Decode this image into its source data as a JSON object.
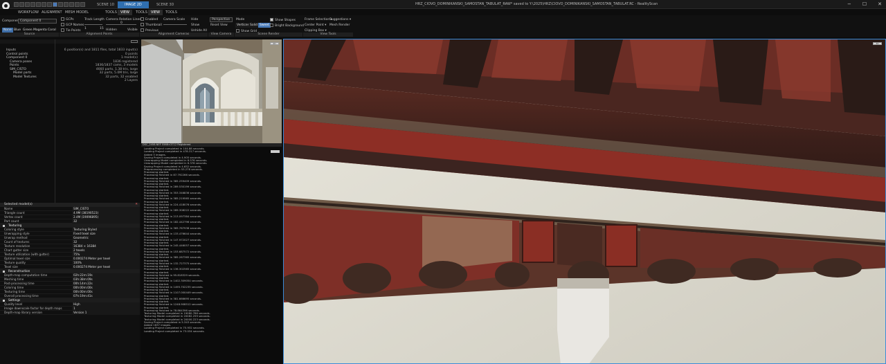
{
  "window": {
    "scene_tabs": [
      "SCENE 1D",
      "IMAGE 2D",
      "SCENE 3D"
    ],
    "active_scene_tab": "IMAGE 2D",
    "title": "HRZ_CIOVO_DOMINIKANSKI_SAMOSTAN_TABULAT_RAW* saved to Y:\\2025\\HRZ\\CIOVO_DOMINIKANSKI_SAMOSTAN_TABULAT.RC - RealityScan",
    "controls": [
      "−",
      "☐",
      "✕"
    ]
  },
  "menu": {
    "items": [
      "WORKFLOW",
      "ALIGNMENT",
      "MESH MODEL",
      "TOOLS",
      "VIEW",
      "TOOLS",
      "VIEW",
      "TOOLS"
    ],
    "active": [
      4,
      6
    ]
  },
  "ribbon": {
    "source": {
      "component_label": "Component",
      "component_value": "Component 0",
      "swatches": [
        "None",
        "Blue",
        "Green",
        "Magenta",
        "Coral"
      ],
      "active_swatch": "None",
      "group_label": "Source"
    },
    "alignment_points": {
      "gcps": "GCPs",
      "gcp_names": "GCP Names",
      "tie_points": "Tie Points",
      "track_length": "Track Length",
      "track_min": "1",
      "track_max": "15",
      "group_label": "Alignment Points"
    },
    "camera_relation": {
      "label": "Camera Relation Lines",
      "low": "0",
      "hidden": "Hidden",
      "visible": "Visible"
    },
    "alignment_cameras": {
      "enabled": "Enabled",
      "thumbnail": "Thumbnail",
      "previous": "Previous",
      "camera_scale": "Camera Scale",
      "hide": "Hide",
      "show": "Show",
      "unhide_all": "Unhide All",
      "group_label": "Alignment Cameras"
    },
    "view_camera": {
      "projection": "Perspective",
      "reset": "Reset View",
      "group_label": "View Camera"
    },
    "scene_render": {
      "mode": "Mode",
      "mode_buttons": [
        "Vertices",
        "Solid",
        "Sweet"
      ],
      "active_mode": "Sweet",
      "show_grid": "Show Grid",
      "show_shapes": "Show Shapes",
      "bright_background": "Bright Background",
      "group_label": "Scene Render"
    },
    "view_tools": {
      "frame_selection": "Frame Selection",
      "suggestions": "Suggestions",
      "center_point": "Center Point",
      "mesh_render": "Mesh Render",
      "clipping_box": "Clipping Box",
      "group_label": "View Tools"
    }
  },
  "tree": [
    {
      "label": "Inputs",
      "value": "6 position(s) and 1811 files, total 1833 input(s)",
      "indent": 0
    },
    {
      "label": "Control points",
      "value": "0 points",
      "indent": 0
    },
    {
      "label": "Component 0",
      "value": "1 model(s)",
      "indent": 0
    },
    {
      "label": "Camera poses",
      "value": "1836 registered",
      "indent": 1
    },
    {
      "label": "Points",
      "value": "1836/1837 cams, 3 models",
      "indent": 1
    },
    {
      "label": "SIM_CISTO",
      "value": "4660 parts, 1.38 tris, large",
      "indent": 1
    },
    {
      "label": "Model parts",
      "value": "32 parts, 5.0M tris, large",
      "indent": 2
    },
    {
      "label": "Model Textures",
      "value": "32 parts, 32 enabled",
      "indent": 2
    },
    {
      "label": "",
      "value": "2 Layers",
      "indent": 2
    }
  ],
  "props": {
    "header": "Selected model(s)",
    "rows": [
      {
        "k": "Name",
        "v": "SIM_CISTO",
        "sec": false
      },
      {
        "k": "Triangle count",
        "v": "4.9M (38190523)",
        "sec": false
      },
      {
        "k": "Vertex count",
        "v": "2.4M (19096895)",
        "sec": false
      },
      {
        "k": "Part count",
        "v": "32",
        "sec": false
      },
      {
        "k": "Texturing",
        "v": "",
        "sec": true
      },
      {
        "k": "Coloring style",
        "v": "Texturing Styled",
        "sec": false
      },
      {
        "k": "Unwrapping style",
        "v": "Fixed texel size",
        "sec": false
      },
      {
        "k": "Unwrap method",
        "v": "Geometric",
        "sec": false
      },
      {
        "k": "Count of textures",
        "v": "32",
        "sec": false
      },
      {
        "k": "Texture resolution",
        "v": "16384 × 16384",
        "sec": false
      },
      {
        "k": "Chart gutter size",
        "v": "2 texels",
        "sec": false
      },
      {
        "k": "Texture utilization (with gutter)",
        "v": "75%",
        "sec": false
      },
      {
        "k": "Optimal texel size",
        "v": "0.000274 Meter per texel",
        "sec": false
      },
      {
        "k": "Texture quality",
        "v": "100%",
        "sec": false
      },
      {
        "k": "Texel size",
        "v": "0.000274 Meter per texel",
        "sec": false
      },
      {
        "k": "Reconstruction",
        "v": "",
        "sec": true
      },
      {
        "k": "Depth-map computation time",
        "v": "02h:22m:19s",
        "sec": false
      },
      {
        "k": "Meshing time",
        "v": "03h:38m:09s",
        "sec": false
      },
      {
        "k": "Post-processing time",
        "v": "00h:14m:22s",
        "sec": false
      },
      {
        "k": "Coloring time",
        "v": "00h:00m:00s",
        "sec": false
      },
      {
        "k": "Texturing time",
        "v": "00h:00m:00s",
        "sec": false
      },
      {
        "k": "Overall processing time",
        "v": "07h:19m:41s",
        "sec": false
      },
      {
        "k": "Settings",
        "v": "",
        "sec": true
      },
      {
        "k": "Quality level",
        "v": "High",
        "sec": false
      },
      {
        "k": "Image downscale factor for depth maps",
        "v": "1",
        "sec": false
      },
      {
        "k": "Depth-map library version",
        "v": "Version 1",
        "sec": false
      }
    ]
  },
  "photo_badge_2d": "2D",
  "photo_caption": "DSC_2458.NEF 5568×3712 Registered",
  "log_lines": [
    "Loading Project completed in 104.88 seconds.",
    "Loading Project completed in 478.317 seconds.",
    "Added 3 images.",
    "Saving Project completed in 4.905 seconds.",
    "Unwrapping Model completed in 6.576 seconds.",
    "Unwrapping Model completed in 6.376 seconds.",
    "Saving Project completed in 4.652 seconds.",
    "Preprocessing completed in 53.276 seconds.",
    "Processing started.",
    "Processing finished in 87.792266 seconds.",
    "Processing started.",
    "Processing finished in 385.259409 seconds.",
    "Processing started.",
    "Processing finished in 289.530199 seconds.",
    "Processing started.",
    "Processing finished in 353.346836 seconds.",
    "Processing started.",
    "Processing finished in 385.219565 seconds.",
    "Processing started.",
    "Processing finished in 224.418076 seconds.",
    "Processing started.",
    "Processing finished in 289.308222 seconds.",
    "Processing started.",
    "Processing finished in 213.097384 seconds.",
    "Processing started.",
    "Processing finished in 182.442796 seconds.",
    "Processing started.",
    "Processing finished in 365.767938 seconds.",
    "Processing started.",
    "Processing finished in 133.476644 seconds.",
    "Processing started.",
    "Processing finished in 147.972027 seconds.",
    "Processing started.",
    "Processing finished in 245.446057 seconds.",
    "Processing started.",
    "Processing finished in 153.687572 seconds.",
    "Processing started.",
    "Processing finished in 385.267365 seconds.",
    "Processing started.",
    "Processing finished in 132.727375 seconds.",
    "Processing started.",
    "Processing finished in 136.302565 seconds.",
    "Processing started.",
    "Processing finished in 95.818329 seconds.",
    "Processing started.",
    "Processing finished in 1402.309054 seconds.",
    "Processing started.",
    "Processing finished in 1495.702235 seconds.",
    "Processing started.",
    "Processing finished in 1107.000449 seconds.",
    "Processing started.",
    "Processing finished in 381.666695 seconds.",
    "Processing started.",
    "Processing finished in 1248.908512 seconds.",
    "Processing started.",
    "Processing finished in 78.864396 seconds.",
    "Texturing Model completed in 19080.786 seconds.",
    "Texturing Model completed in 20082.259 seconds.",
    "Texturing Model completed in 20000.223 seconds.",
    "Saving Project completed in 5.343 seconds.",
    "Added 1837 images.",
    "Loading Project completed in 75.932 seconds.",
    "Loading Project completed in 73.034 seconds."
  ],
  "view3d_badge": "3D"
}
